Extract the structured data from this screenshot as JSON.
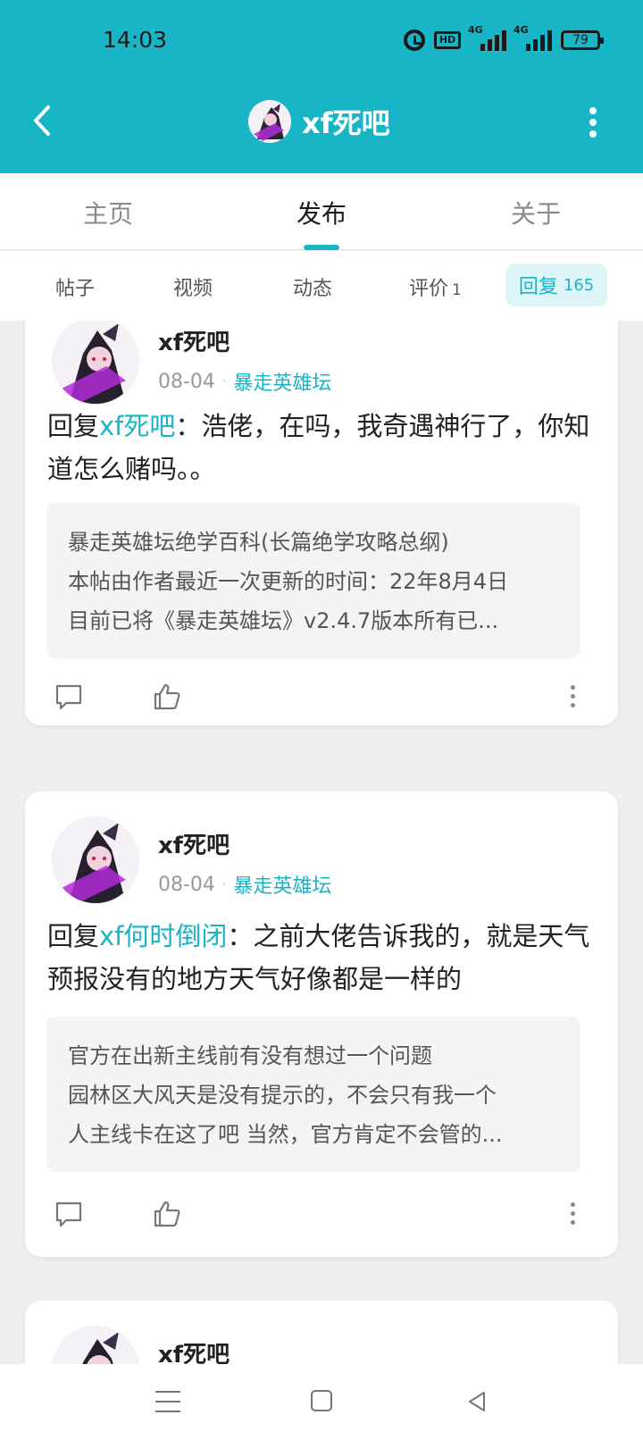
{
  "status_bar": {
    "time": "14:03",
    "network_1": "4G",
    "network_2": "4G",
    "hd_label": "HD",
    "battery": "79"
  },
  "header": {
    "title": "xf死吧",
    "back_icon": "chevron-left-icon",
    "more_icon": "more-vertical-icon",
    "accent_color": "#17b5c5"
  },
  "main_tabs": [
    {
      "label": "主页",
      "active": false
    },
    {
      "label": "发布",
      "active": true
    },
    {
      "label": "关于",
      "active": false
    }
  ],
  "sub_tabs": {
    "posts": "帖子",
    "videos": "视频",
    "dynamics": "动态",
    "reviews": "评价",
    "reviews_count": "1",
    "replies": "回复",
    "replies_count": "165"
  },
  "posts": [
    {
      "username": "xf死吧",
      "date": "08-04",
      "forum": "暴走英雄坛",
      "reply_prefix": "回复",
      "reply_target": "xf死吧",
      "reply_body": "：浩佬，在吗，我奇遇神行了，你知道怎么赌吗。。",
      "quote_title": "暴走英雄坛绝学百科(长篇绝学攻略总纲)",
      "quote_line1": "本帖由作者最近一次更新的时间：22年8月4日",
      "quote_line2": "目前已将《暴走英雄坛》v2.4.7版本所有已..."
    },
    {
      "username": "xf死吧",
      "date": "08-04",
      "forum": "暴走英雄坛",
      "reply_prefix": "回复",
      "reply_target": "xf何时倒闭",
      "reply_body": "：之前大佬告诉我的，就是天气预报没有的地方天气好像都是一样的",
      "quote_title": "官方在出新主线前有没有想过一个问题",
      "quote_line1": "园林区大风天是没有提示的，不会只有我一个",
      "quote_line2": "人主线卡在这了吧 当然，官方肯定不会管的..."
    },
    {
      "username": "xf死吧"
    }
  ],
  "actions": {
    "comment_icon": "comment-icon",
    "like_icon": "thumbs-up-icon",
    "more_icon": "more-vertical-icon"
  },
  "navbar": {
    "menu_icon": "menu-icon",
    "home_icon": "home-square-icon",
    "back_icon": "back-triangle-icon"
  }
}
